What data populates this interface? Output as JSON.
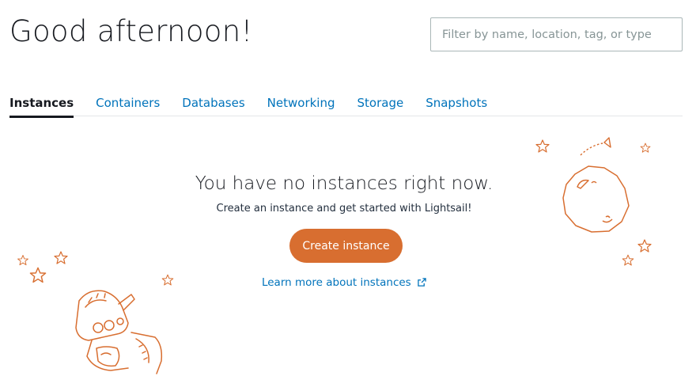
{
  "header": {
    "greeting": "Good afternoon!",
    "search_placeholder": "Filter by name, location, tag, or type"
  },
  "tabs": [
    {
      "label": "Instances",
      "active": true
    },
    {
      "label": "Containers",
      "active": false
    },
    {
      "label": "Databases",
      "active": false
    },
    {
      "label": "Networking",
      "active": false
    },
    {
      "label": "Storage",
      "active": false
    },
    {
      "label": "Snapshots",
      "active": false
    }
  ],
  "empty_state": {
    "title": "You have no instances right now.",
    "subtitle": "Create an instance and get started with Lightsail!",
    "create_button": "Create instance",
    "learn_more": "Learn more about instances",
    "learn_more_icon": "external-link-icon"
  },
  "illustrations": {
    "robot": "robot-astronaut-illustration",
    "planet": "planet-illustration",
    "stars": "star-icon"
  },
  "colors": {
    "accent": "#d86e30",
    "link": "#0073bb",
    "text": "#16191f"
  }
}
